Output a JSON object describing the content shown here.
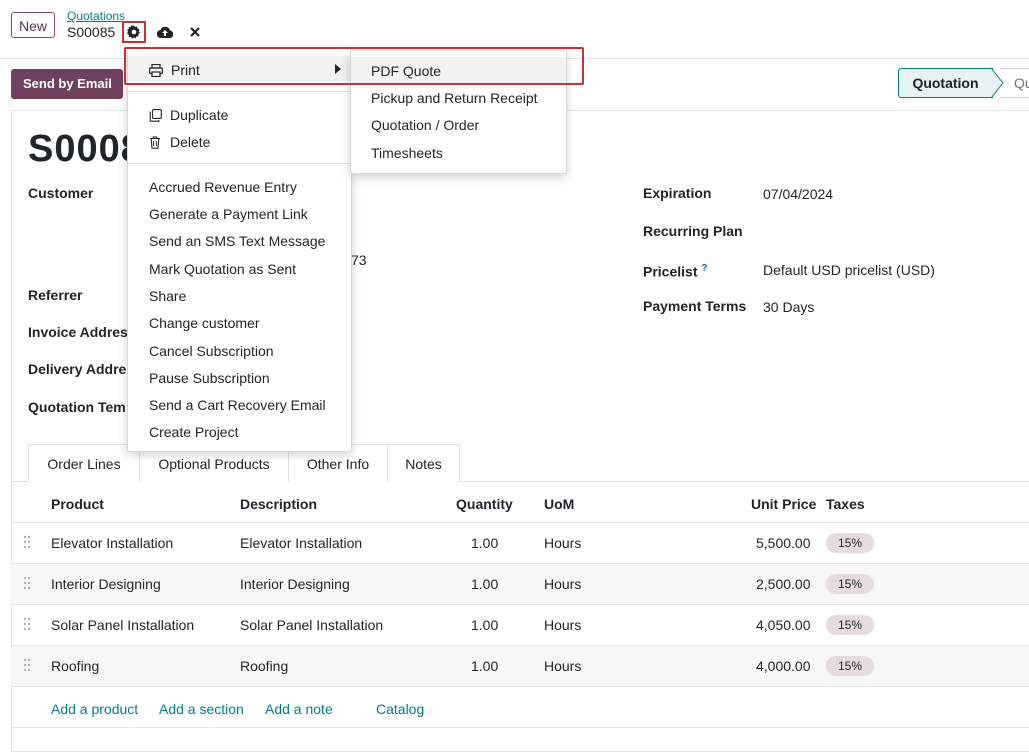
{
  "topbar": {
    "new_label": "New",
    "breadcrumb_parent": "Quotations",
    "record_name": "S00085"
  },
  "control": {
    "send_email_label": "Send by Email",
    "status_active": "Quotation",
    "status_next": "Qu"
  },
  "form": {
    "title": "S0008",
    "left_labels": {
      "customer": "Customer",
      "referrer": "Referrer",
      "invoice_address": "Invoice Addres",
      "delivery_address": "Delivery Addre",
      "quotation_template": "Quotation Tem"
    },
    "partial_value": "73",
    "right_fields": {
      "expiration_label": "Expiration",
      "expiration_value": "07/04/2024",
      "recurring_label": "Recurring Plan",
      "pricelist_label": "Pricelist",
      "pricelist_help": "?",
      "pricelist_value": "Default USD pricelist (USD)",
      "payment_terms_label": "Payment Terms",
      "payment_terms_value": "30 Days"
    }
  },
  "tabs": [
    "Order Lines",
    "Optional Products",
    "Other Info",
    "Notes"
  ],
  "table": {
    "headers": {
      "product": "Product",
      "description": "Description",
      "quantity": "Quantity",
      "uom": "UoM",
      "unit_price": "Unit Price",
      "taxes": "Taxes"
    },
    "rows": [
      {
        "product": "Elevator Installation",
        "description": "Elevator Installation",
        "quantity": "1.00",
        "uom": "Hours",
        "unit_price": "5,500.00",
        "tax": "15%"
      },
      {
        "product": "Interior Designing",
        "description": "Interior Designing",
        "quantity": "1.00",
        "uom": "Hours",
        "unit_price": "2,500.00",
        "tax": "15%"
      },
      {
        "product": "Solar Panel Installation",
        "description": "Solar Panel Installation",
        "quantity": "1.00",
        "uom": "Hours",
        "unit_price": "4,050.00",
        "tax": "15%"
      },
      {
        "product": "Roofing",
        "description": "Roofing",
        "quantity": "1.00",
        "uom": "Hours",
        "unit_price": "4,000.00",
        "tax": "15%"
      }
    ],
    "add_links": {
      "product": "Add a product",
      "section": "Add a section",
      "note": "Add a note",
      "catalog": "Catalog"
    }
  },
  "dropdown": {
    "print": "Print",
    "duplicate": "Duplicate",
    "delete": "Delete",
    "actions": [
      "Accrued Revenue Entry",
      "Generate a Payment Link",
      "Send an SMS Text Message",
      "Mark Quotation as Sent",
      "Share",
      "Change customer",
      "Cancel Subscription",
      "Pause Subscription",
      "Send a Cart Recovery Email",
      "Create Project"
    ],
    "print_submenu": [
      "PDF Quote",
      "Pickup and Return Receipt",
      "Quotation / Order",
      "Timesheets"
    ]
  },
  "colors": {
    "primary": "#71405f",
    "link": "#017e84",
    "highlight": "#c03535"
  }
}
